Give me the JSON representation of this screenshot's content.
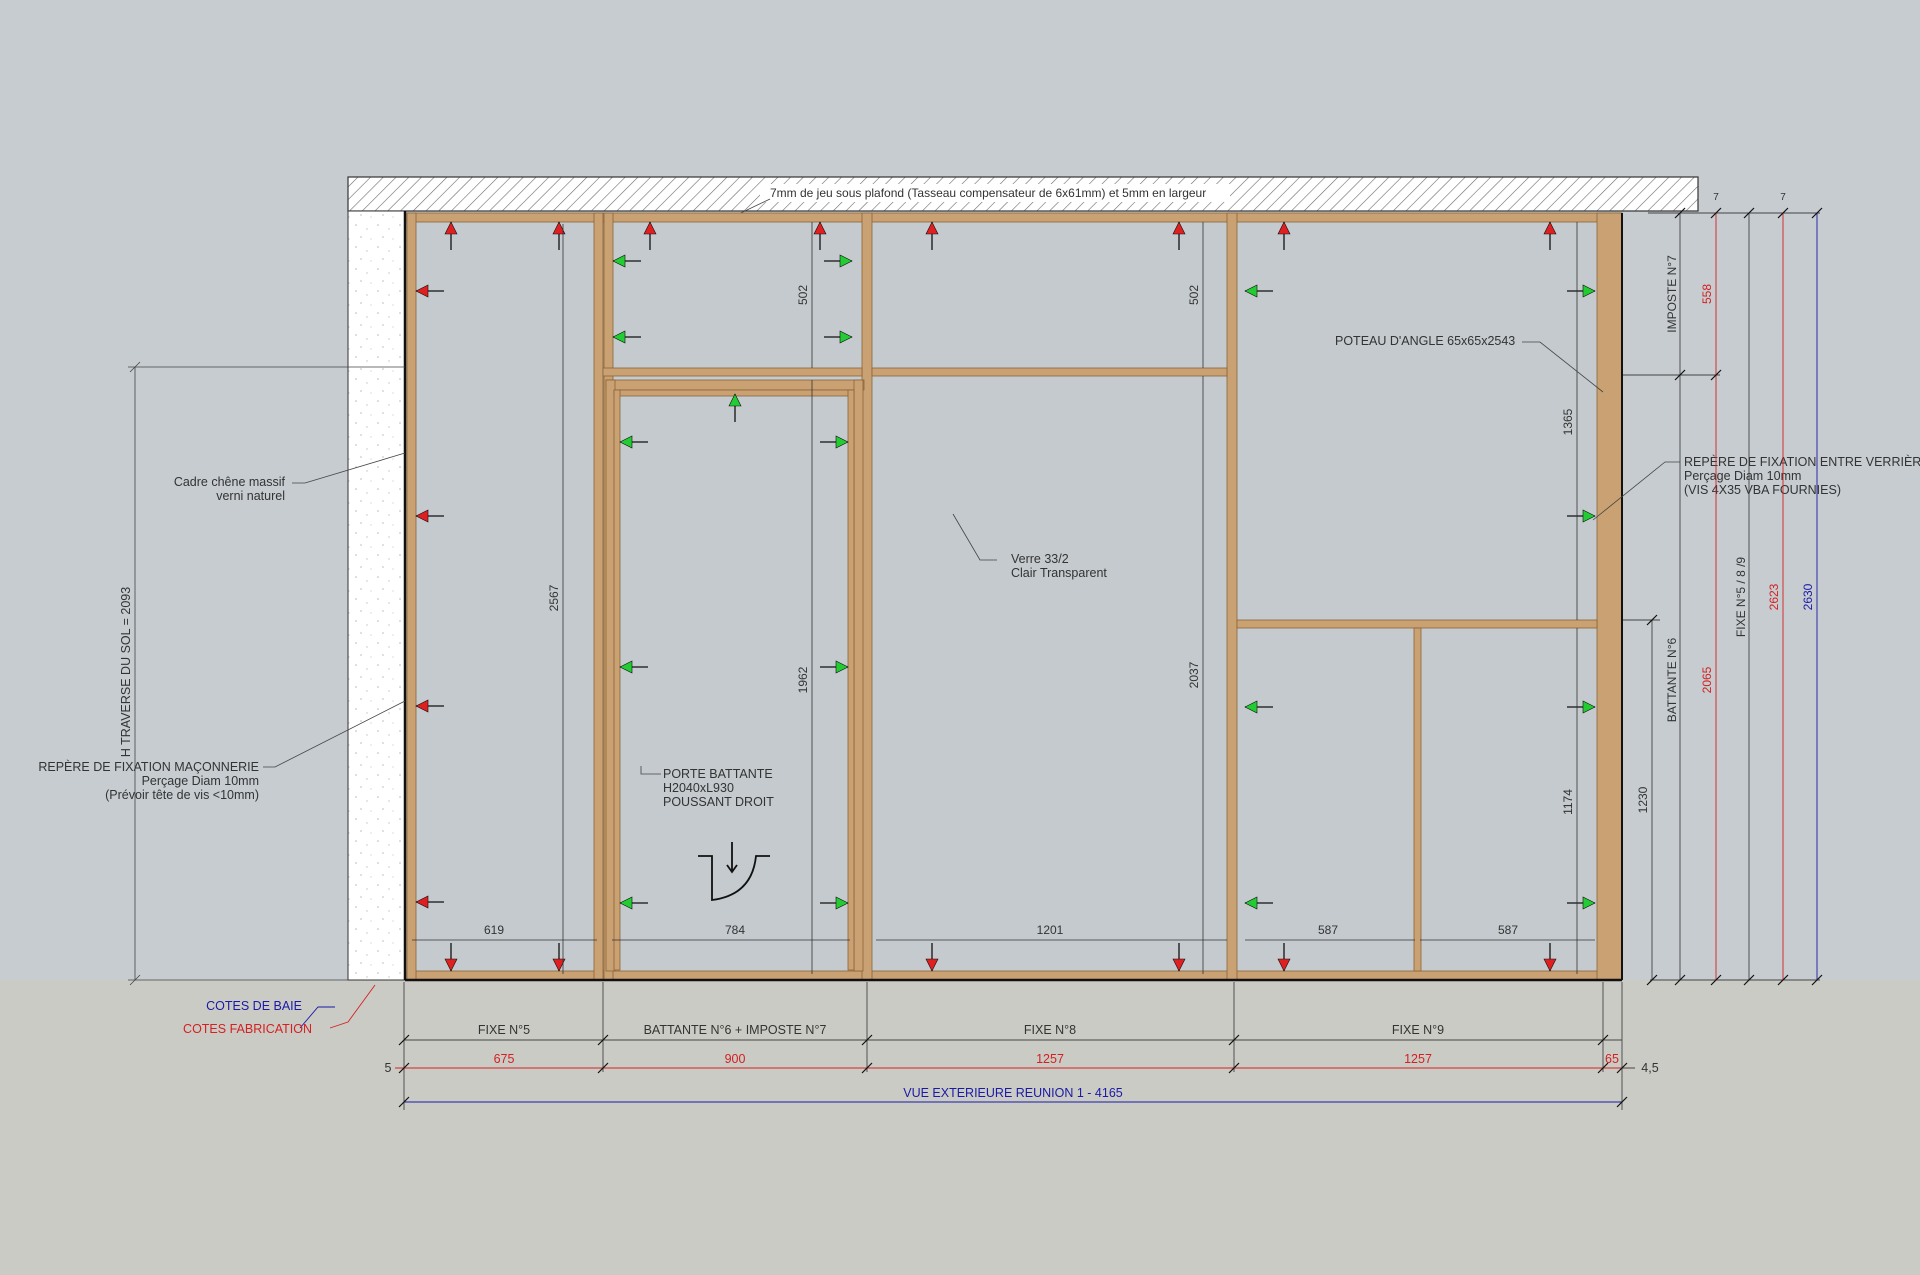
{
  "header_note": "7mm de jeu sous plafond (Tasseau compensateur de 6x61mm) et 5mm en largeur",
  "annotations": {
    "frame": [
      "Cadre chêne massif",
      "verni naturel"
    ],
    "masonry_fixing": [
      "REPÈRE DE FIXATION MAÇONNERIE",
      "Perçage Diam 10mm",
      "(Prévoir tête de vis <10mm)"
    ],
    "door": [
      "PORTE BATTANTE",
      "H2040xL930",
      "POUSSANT DROIT"
    ],
    "glass": [
      "Verre 33/2",
      "Clair Transparent"
    ],
    "corner_post": "POTEAU D'ANGLE 65x65x2543",
    "glass_fixing": [
      "REPÈRE DE FIXATION ENTRE VERRIÈRE",
      "Perçage Diam 10mm",
      "(VIS 4X35 VBA FOURNIES)"
    ]
  },
  "legend": {
    "bay": "COTES DE BAIE",
    "fabrication": "COTES FABRICATION"
  },
  "colors": {
    "background": "#c6ccd0",
    "floor": "#cbcbc6",
    "glass": "#c4cacd",
    "oak": "#c9a172",
    "oak_edge": "#8a6438",
    "wall_fill": "#ffffff",
    "bay_dims": "#1a1aa6",
    "fab_dims": "#d42020",
    "arrow_red": "#e02020",
    "arrow_green": "#22cc33"
  },
  "dimensions": {
    "panel_widths": [
      "619",
      "784",
      "1201",
      "587",
      "587"
    ],
    "vertical": [
      "2567",
      "502",
      "1962",
      "502",
      "2037",
      "1365",
      "1174",
      "1230"
    ],
    "left_height": "H TRAVERSE DU SOL = 2093",
    "right_labels": [
      "IMPOSTE N°7",
      "BATTANTE N°6",
      "FIXE N°5 / 8 /9"
    ],
    "right_red": [
      "558",
      "2065",
      "2623"
    ],
    "right_blue": "2630",
    "right_gap": [
      "7",
      "7"
    ],
    "bottom_labels": [
      "FIXE N°5",
      "BATTANTE N°6 + IMPOSTE N°7",
      "FIXE N°8",
      "FIXE N°9"
    ],
    "bottom_red": [
      "675",
      "900",
      "1257",
      "1257",
      "65"
    ],
    "bottom_small": [
      "5",
      "4,5"
    ],
    "total": "VUE EXTERIEURE REUNION 1 - 4165"
  }
}
